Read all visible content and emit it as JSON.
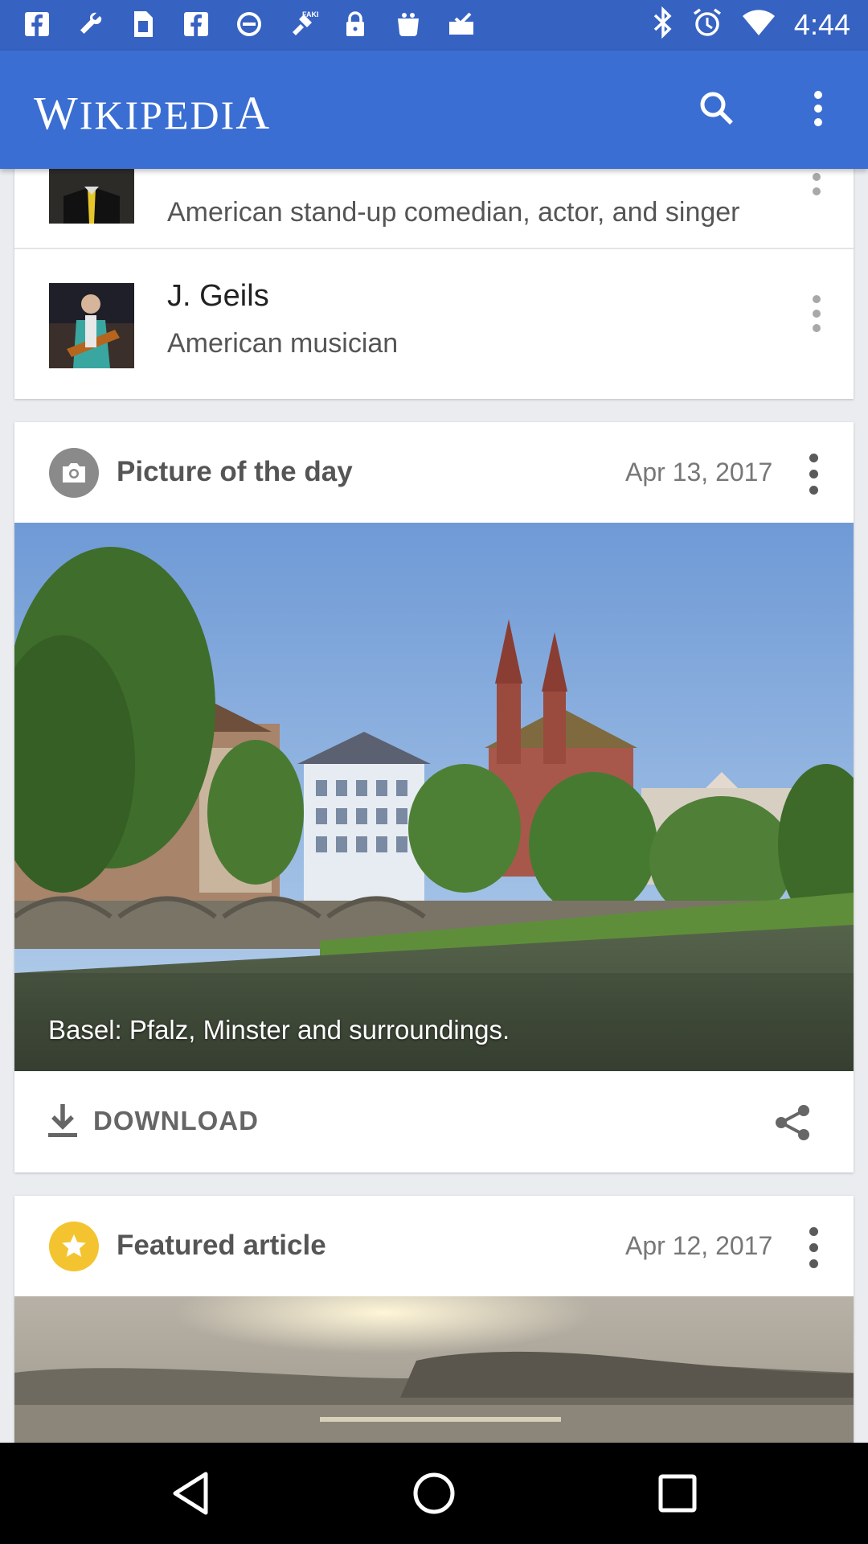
{
  "status_bar": {
    "time": "4:44",
    "left_icons": [
      "facebook-icon",
      "wrench-icon",
      "sim-icon",
      "facebook-icon",
      "block-icon",
      "fake-gps-icon",
      "lock-icon",
      "bag-icon",
      "inbox-check-icon"
    ],
    "right_icons": [
      "bluetooth-icon",
      "alarm-icon",
      "wifi-icon"
    ]
  },
  "app_bar": {
    "title_first": "W",
    "title_mid": "IKIPEDI",
    "title_last": "A",
    "actions": [
      "search-icon",
      "more-vert-icon"
    ]
  },
  "top_list": {
    "items": [
      {
        "title": "",
        "description": "American stand-up comedian, actor, and singer"
      },
      {
        "title": "J. Geils",
        "description": "American musician"
      }
    ]
  },
  "picture_of_day": {
    "icon": "camera-icon",
    "title": "Picture of the day",
    "date": "Apr 13, 2017",
    "caption": "Basel: Pfalz, Minster and surroundings.",
    "download_label": "DOWNLOAD",
    "download_icon": "download-icon",
    "share_icon": "share-icon"
  },
  "featured_article": {
    "icon": "star-icon",
    "icon_color": "#f4c430",
    "title": "Featured article",
    "date": "Apr 12, 2017"
  },
  "nav_bar": {
    "buttons": [
      "back-icon",
      "home-icon",
      "recents-icon"
    ]
  },
  "colors": {
    "app_bar": "#3b6ed3",
    "status_bar": "#3662c2",
    "background": "#eaecf0"
  }
}
